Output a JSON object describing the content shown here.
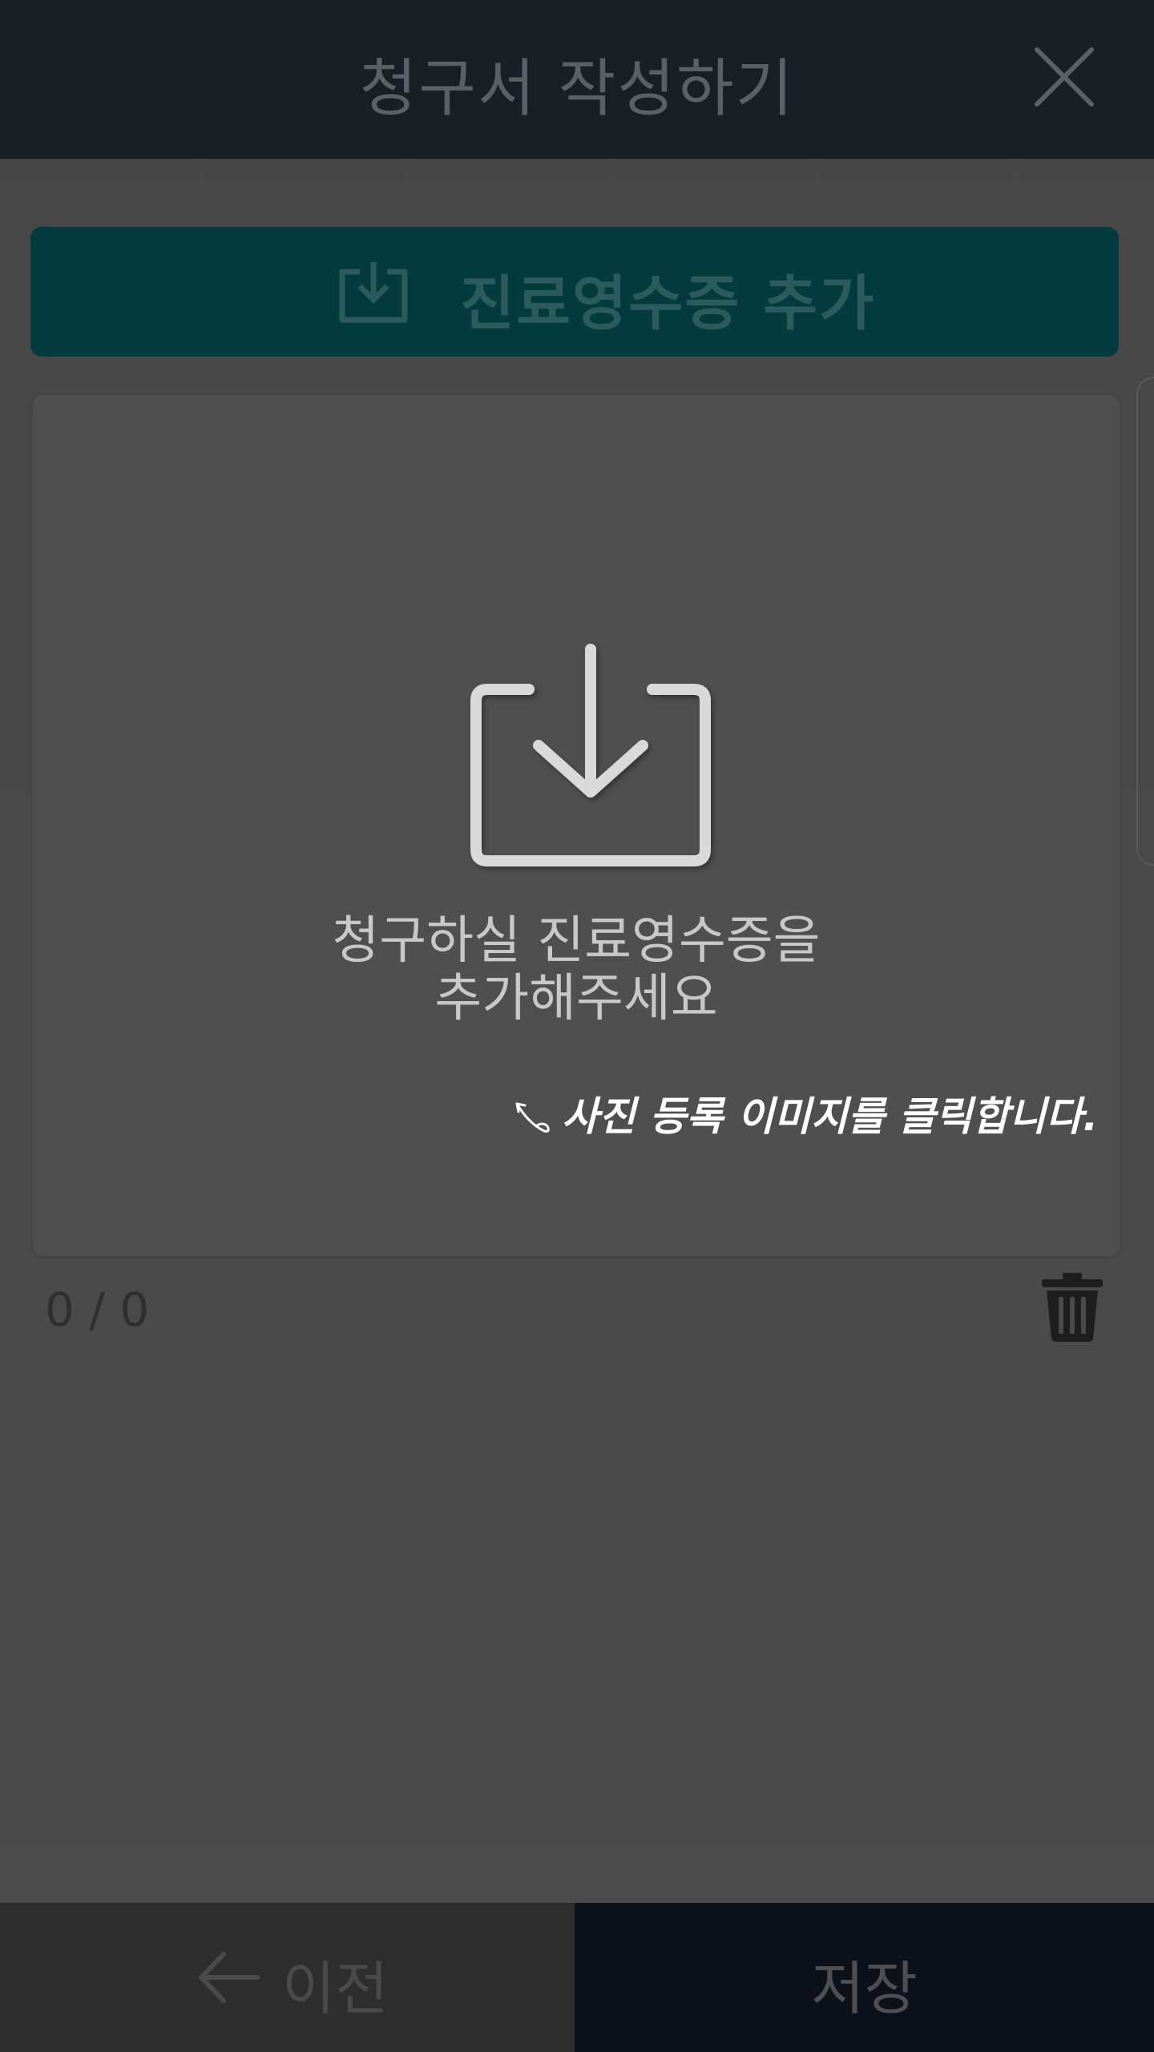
{
  "header": {
    "title": "청구서 작성하기",
    "close_icon": "close-icon"
  },
  "add_receipt": {
    "label": "진료영수증 추가",
    "icon": "download-box-icon",
    "color": "#043b3f"
  },
  "preview": {
    "placeholder_line1": "청구하실 진료영수증을",
    "placeholder_line2": "추가해주세요",
    "hint": "사진 등록 이미지를 클릭합니다.",
    "icon": "download-box-icon"
  },
  "pager": {
    "counter": "0 / 0",
    "trash_icon": "trash-icon"
  },
  "bottom": {
    "prev_label": "이전",
    "prev_icon": "arrow-left-icon",
    "save_label": "저장"
  }
}
